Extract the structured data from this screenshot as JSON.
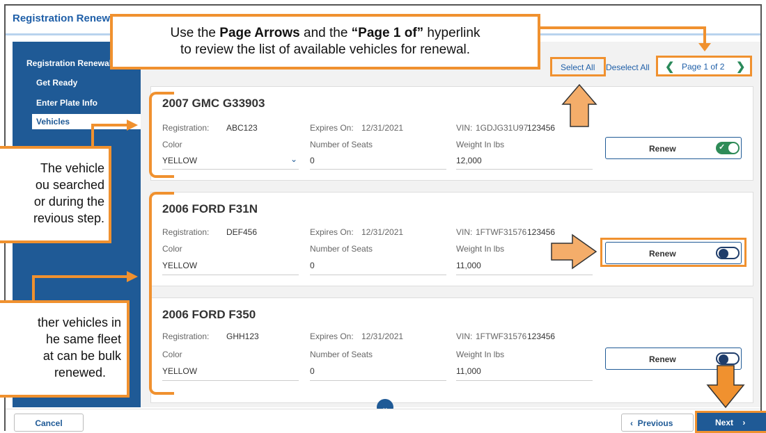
{
  "app": {
    "title": "Registration Renewal"
  },
  "sidebar": {
    "title": "Registration Renewal",
    "items": [
      {
        "label": "Get Ready"
      },
      {
        "label": "Enter Plate Info"
      },
      {
        "label": "Vehicles"
      }
    ]
  },
  "toolbar": {
    "select_all": "Select All",
    "deselect_all": "Deselect All",
    "page_label": "Page 1 of 2"
  },
  "vehicles": [
    {
      "title": "2007 GMC G33903",
      "registration_label": "Registration:",
      "registration": "ABC123",
      "expires_label": "Expires On:",
      "expires": "12/31/2021",
      "vin_label": "VIN:",
      "vin_prefix": "1GDJG31U97",
      "vin_suffix": "123456",
      "color_label": "Color",
      "color": "YELLOW",
      "seats_label": "Number of Seats",
      "seats": "0",
      "weight_label": "Weight In lbs",
      "weight": "12,000",
      "renew_label": "Renew",
      "renew_on": true
    },
    {
      "title": "2006 FORD F31N",
      "registration_label": "Registration:",
      "registration": "DEF456",
      "expires_label": "Expires On:",
      "expires": "12/31/2021",
      "vin_label": "VIN:",
      "vin_prefix": "1FTWF31576",
      "vin_suffix": "123456",
      "color_label": "Color",
      "color": "YELLOW",
      "seats_label": "Number of Seats",
      "seats": "0",
      "weight_label": "Weight In lbs",
      "weight": "11,000",
      "renew_label": "Renew",
      "renew_on": false
    },
    {
      "title": "2006 FORD F350",
      "registration_label": "Registration:",
      "registration": "GHH123",
      "expires_label": "Expires On:",
      "expires": "12/31/2021",
      "vin_label": "VIN:",
      "vin_prefix": "1FTWF31576",
      "vin_suffix": "123456",
      "color_label": "Color",
      "color": "YELLOW",
      "seats_label": "Number of Seats",
      "seats": "0",
      "weight_label": "Weight In lbs",
      "weight": "11,000",
      "renew_label": "Renew",
      "renew_on": false
    }
  ],
  "footer": {
    "cancel": "Cancel",
    "previous": "Previous",
    "next": "Next"
  },
  "callouts": {
    "top_pre": "Use the ",
    "top_bold1": "Page Arrows",
    "top_mid": " and the ",
    "top_bold2": "“Page 1 of”",
    "top_post": " hyperlink",
    "top_line2": "to review the list of available vehicles for renewal.",
    "left1": [
      "The vehicle",
      "ou searched",
      "or during the",
      "revious step."
    ],
    "left2": [
      "ther vehicles in",
      "he same fleet",
      "at can be bulk",
      "renewed."
    ]
  },
  "colors": {
    "accent": "#f0912f",
    "brand": "#1f5a96",
    "toggle_on": "#2e8b57"
  }
}
